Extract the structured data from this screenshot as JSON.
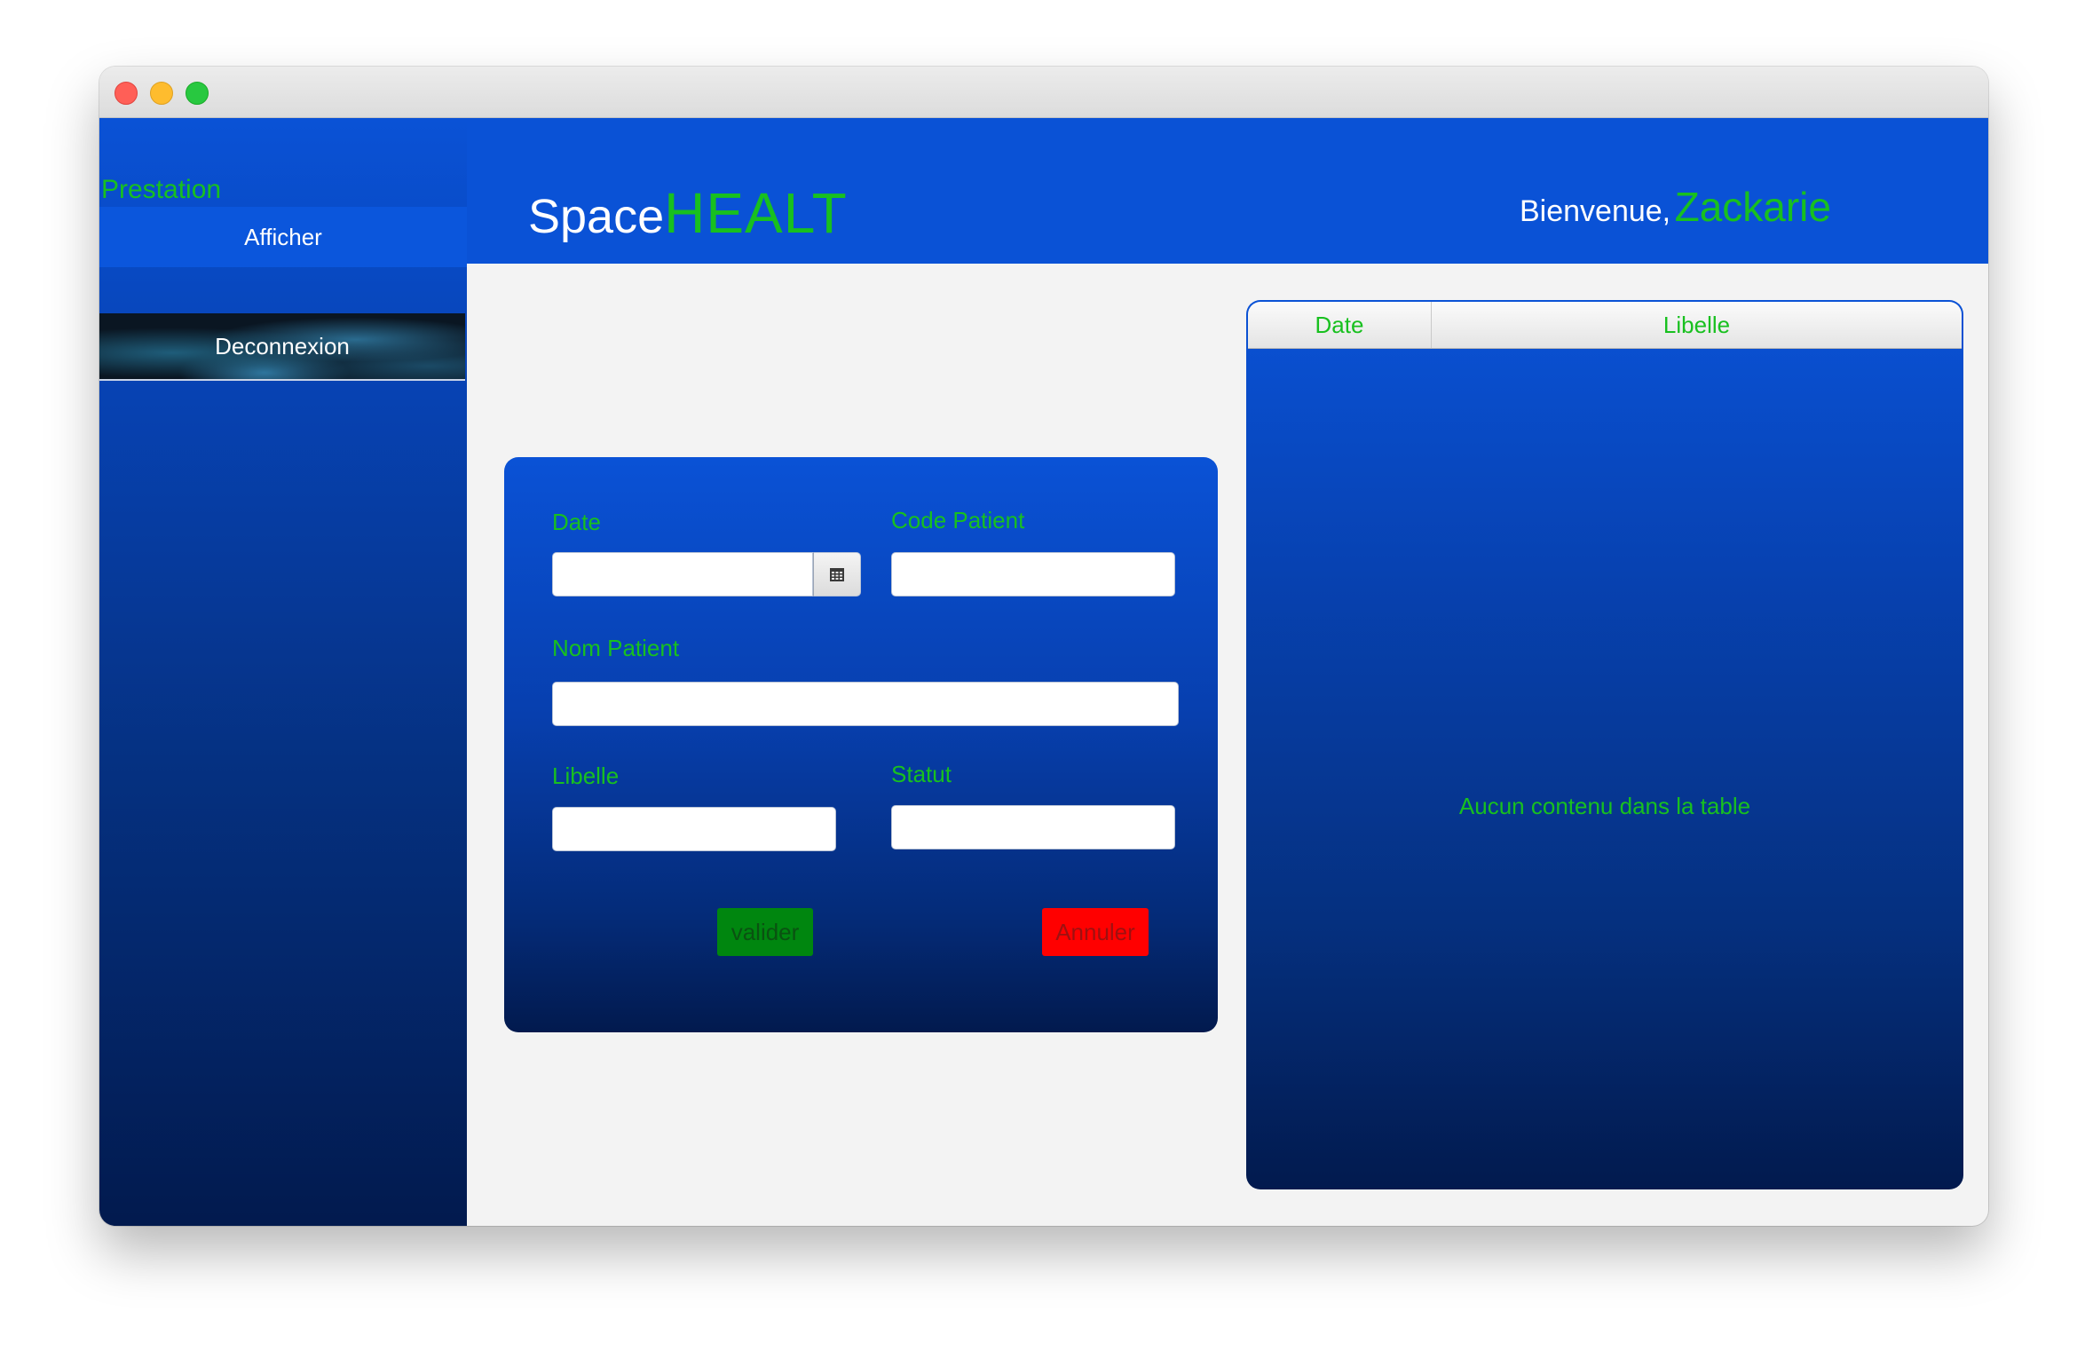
{
  "app": {
    "brand_prefix": "Space",
    "brand_suffix": "HEALT",
    "welcome_text": "Bienvenue,",
    "user_name": "Zackarie"
  },
  "sidebar": {
    "menu_title": "Prestation",
    "items": [
      {
        "label": "Afficher"
      },
      {
        "label": "Deconnexion"
      }
    ]
  },
  "form": {
    "date_label": "Date",
    "date_value": "",
    "code_patient_label": "Code Patient",
    "code_patient_value": "",
    "nom_patient_label": "Nom Patient",
    "nom_patient_value": "",
    "libelle_label": "Libelle",
    "libelle_value": "",
    "statut_label": "Statut",
    "statut_value": "",
    "valider_label": "valider",
    "annuler_label": "Annuler"
  },
  "table": {
    "columns": [
      "Date",
      "Libelle"
    ],
    "rows": [],
    "empty_message": "Aucun contenu dans la table"
  },
  "colors": {
    "primary_blue": "#0a52d6",
    "accent_green": "#18c01f",
    "valider_bg": "#00860f",
    "annuler_bg": "#ff0000"
  },
  "icons": {
    "date_picker": "calendar-icon"
  }
}
